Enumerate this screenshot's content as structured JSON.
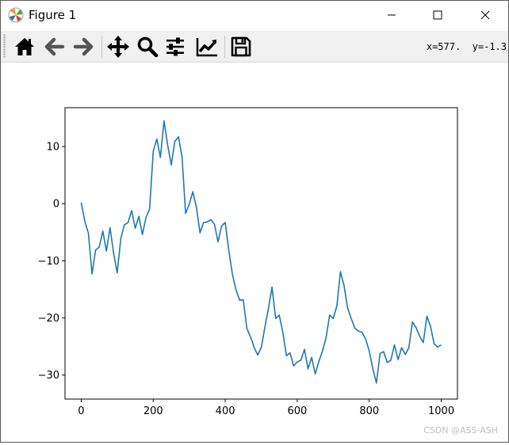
{
  "window": {
    "title": "Figure 1",
    "minimize_label": "Minimize",
    "maximize_label": "Maximize",
    "close_label": "Close"
  },
  "toolbar": {
    "buttons": [
      {
        "name": "home-button",
        "icon": "home-icon"
      },
      {
        "name": "back-button",
        "icon": "arrow-left-icon"
      },
      {
        "name": "forward-button",
        "icon": "arrow-right-icon"
      },
      {
        "name": "pan-button",
        "icon": "move-icon"
      },
      {
        "name": "zoom-button",
        "icon": "magnifier-icon"
      },
      {
        "name": "subplots-button",
        "icon": "sliders-icon"
      },
      {
        "name": "edit-axis-button",
        "icon": "line-chart-icon"
      },
      {
        "name": "save-button",
        "icon": "floppy-disk-icon"
      }
    ],
    "coordinates": "x=577.  y=-1.3"
  },
  "chart_data": {
    "type": "line",
    "title": "",
    "xlabel": "",
    "ylabel": "",
    "xlim": [
      -45,
      1045
    ],
    "ylim": [
      -34.2,
      16.8
    ],
    "xticks": [
      0,
      200,
      400,
      600,
      800,
      1000
    ],
    "yticks": [
      10,
      0,
      -10,
      -20,
      -30
    ],
    "color": "#1f77b4",
    "grid": false,
    "series": [
      {
        "name": "",
        "x": [
          0,
          10,
          20,
          30,
          40,
          50,
          60,
          70,
          80,
          90,
          100,
          110,
          120,
          130,
          140,
          150,
          160,
          170,
          180,
          190,
          200,
          210,
          220,
          230,
          240,
          250,
          260,
          270,
          280,
          290,
          300,
          310,
          320,
          330,
          340,
          350,
          360,
          370,
          380,
          390,
          400,
          410,
          420,
          430,
          440,
          450,
          460,
          470,
          480,
          490,
          500,
          510,
          520,
          530,
          540,
          550,
          560,
          570,
          580,
          590,
          600,
          610,
          620,
          630,
          640,
          650,
          660,
          670,
          680,
          690,
          700,
          710,
          720,
          730,
          740,
          750,
          760,
          770,
          780,
          790,
          800,
          810,
          820,
          830,
          840,
          850,
          860,
          870,
          880,
          890,
          900,
          910,
          920,
          930,
          940,
          950,
          960,
          970,
          980,
          990,
          1000
        ],
        "y": [
          0.2,
          -3.1,
          -5.2,
          -12.3,
          -8.1,
          -7.6,
          -4.8,
          -8.3,
          -4.2,
          -8.7,
          -12.1,
          -6.1,
          -3.7,
          -3.3,
          -1.2,
          -4.3,
          -2.2,
          -5.4,
          -2.4,
          -0.9,
          9.2,
          11.3,
          8.1,
          14.5,
          10.3,
          6.8,
          10.9,
          11.7,
          8.2,
          -1.7,
          -0.1,
          2.1,
          -0.7,
          -5.1,
          -3.3,
          -3.2,
          -2.8,
          -3.6,
          -6.7,
          -3.9,
          -3.3,
          -8.2,
          -12.4,
          -15.1,
          -16.9,
          -16.8,
          -21.8,
          -23.3,
          -25.1,
          -26.5,
          -25.2,
          -21.7,
          -18.3,
          -14.6,
          -20.1,
          -19.5,
          -22.5,
          -26.6,
          -26.1,
          -28.4,
          -27.7,
          -27.4,
          -25.5,
          -28.9,
          -26.9,
          -29.8,
          -27.6,
          -25.8,
          -23.5,
          -19.5,
          -20.1,
          -17.9,
          -11.9,
          -14.3,
          -18.3,
          -20.1,
          -21.8,
          -22.3,
          -22.5,
          -23.7,
          -25.8,
          -28.9,
          -31.4,
          -26.2,
          -25.9,
          -27.8,
          -27.4,
          -24.7,
          -27.3,
          -25.2,
          -26.4,
          -25.2,
          -20.7,
          -21.7,
          -23.2,
          -24.3,
          -19.7,
          -21.4,
          -24.5,
          -25.1,
          -24.7
        ]
      }
    ]
  },
  "watermark": "CSDN @ASS-ASH"
}
